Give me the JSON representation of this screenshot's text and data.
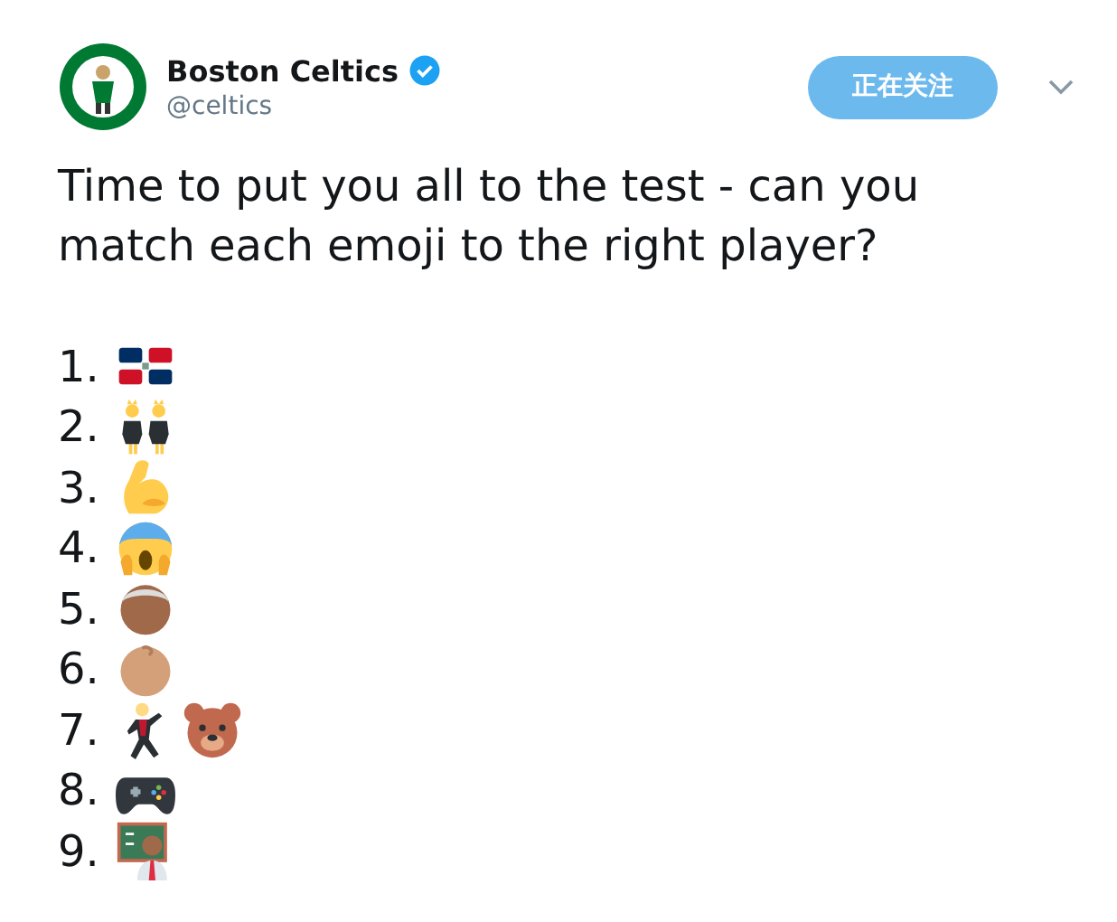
{
  "author": {
    "name": "Boston Celtics",
    "verified": true,
    "handle": "@celtics"
  },
  "follow_button": {
    "label": "正在关注"
  },
  "tweet": {
    "text": "Time to put you all to the test - can you match each emoji to the right player?",
    "list": [
      {
        "number": "1.",
        "emojis": [
          {
            "kind": "flag"
          }
        ]
      },
      {
        "number": "2.",
        "emojis": [
          {
            "kind": "pair-dancers"
          }
        ]
      },
      {
        "number": "3.",
        "emojis": [
          {
            "kind": "biceps"
          }
        ]
      },
      {
        "number": "4.",
        "emojis": [
          {
            "kind": "scream"
          }
        ]
      },
      {
        "number": "5.",
        "emojis": [
          {
            "kind": "old-man"
          }
        ]
      },
      {
        "number": "6.",
        "emojis": [
          {
            "kind": "baby"
          }
        ]
      },
      {
        "number": "7.",
        "emojis": [
          {
            "kind": "dancer"
          },
          {
            "kind": "bear"
          }
        ]
      },
      {
        "number": "8.",
        "emojis": [
          {
            "kind": "gamepad"
          }
        ]
      },
      {
        "number": "9.",
        "emojis": [
          {
            "kind": "teacher"
          }
        ]
      }
    ]
  }
}
